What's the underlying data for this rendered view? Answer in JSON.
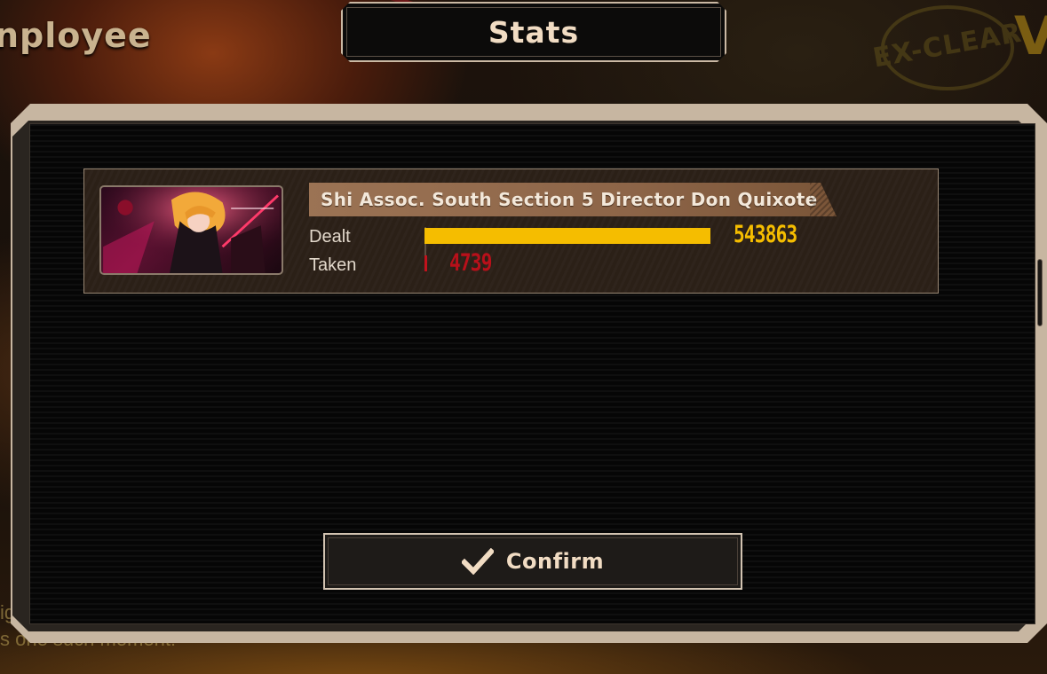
{
  "background": {
    "heading_fragment": "nployee",
    "corner_letter": "V",
    "stamp_text": "EX-CLEAR",
    "caption_line1": "igh",
    "caption_line2": "s one such moment!"
  },
  "dialog": {
    "title": "Stats",
    "confirm_label": "Confirm"
  },
  "stats": [
    {
      "name": "Shi Assoc. South Section 5 Director Don Quixote",
      "dealt_label": "Dealt",
      "taken_label": "Taken",
      "dealt": 543863,
      "taken": 4739,
      "dealt_text": "543863",
      "taken_text": "4739"
    }
  ],
  "colors": {
    "dealt": "#f5bd00",
    "taken": "#c1121c",
    "frame": "#c7b6a1",
    "banner": "#9b7354"
  },
  "icons": {
    "confirm": "checkmark-icon"
  }
}
